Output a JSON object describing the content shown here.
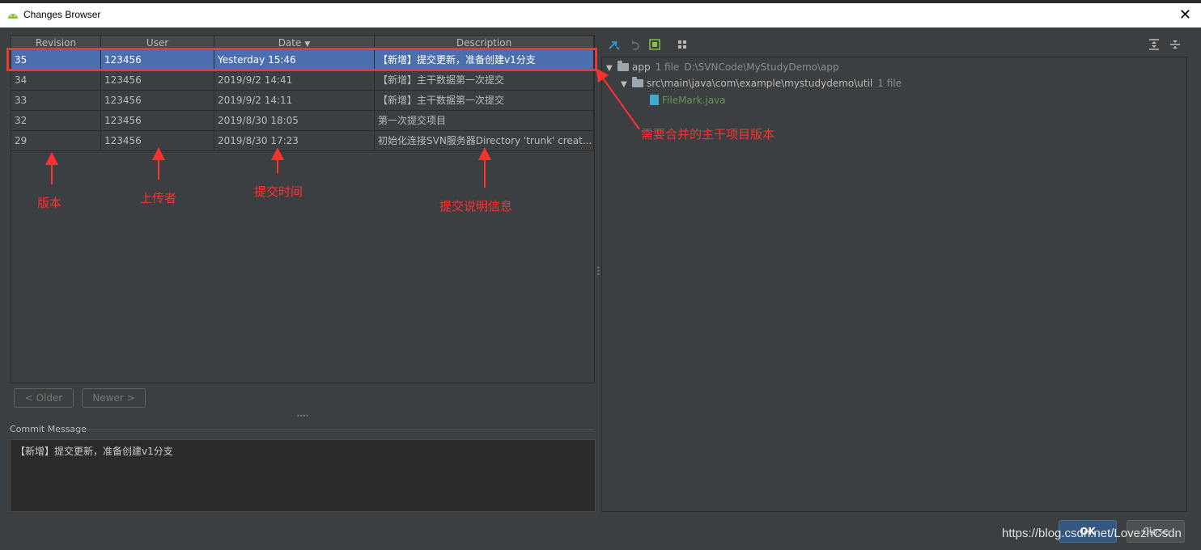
{
  "window": {
    "title": "Changes Browser",
    "close_glyph": "✕"
  },
  "table": {
    "columns": [
      "Revision",
      "User",
      "Date",
      "Description"
    ],
    "sort_indicator": "▼",
    "rows": [
      {
        "revision": "35",
        "user": "123456",
        "date": "Yesterday 15:46",
        "description": "【新增】提交更新，准备创建v1分支",
        "selected": true
      },
      {
        "revision": "34",
        "user": "123456",
        "date": "2019/9/2 14:41",
        "description": "【新增】主干数据第一次提交",
        "selected": false
      },
      {
        "revision": "33",
        "user": "123456",
        "date": "2019/9/2 14:11",
        "description": "【新增】主干数据第一次提交",
        "selected": false
      },
      {
        "revision": "32",
        "user": "123456",
        "date": "2019/8/30 18:05",
        "description": "第一次提交项目",
        "selected": false
      },
      {
        "revision": "29",
        "user": "123456",
        "date": "2019/8/30 17:23",
        "description": "初始化连接SVN服务器Directory 'trunk' creat...",
        "selected": false
      }
    ]
  },
  "nav": {
    "older_label": "< Older",
    "newer_label": "Newer >"
  },
  "commit": {
    "label": "Commit Message",
    "text": "【新增】提交更新，准备创建v1分支"
  },
  "tree": {
    "root": {
      "name": "app",
      "count": "1 file",
      "path": "D:\\SVNCode\\MyStudyDemo\\app"
    },
    "folder": {
      "name": "src\\main\\java\\com\\example\\mystudydemo\\util",
      "count": "1 file"
    },
    "file": {
      "name": "FileMark.java"
    }
  },
  "toolbar": {
    "icons": [
      "merge-arrow-icon",
      "revert-icon",
      "diff-icon",
      "group-by-icon",
      "expand-all-icon",
      "collapse-all-icon"
    ]
  },
  "annotations": {
    "revision": "版本",
    "user": "上传者",
    "date": "提交时间",
    "description": "提交说明信息",
    "trunk": "需要合并的主干项目版本"
  },
  "buttons": {
    "ok": "OK",
    "close": "Close"
  },
  "watermark": "https://blog.csdn.net/LovezhCsdn",
  "colors": {
    "selection": "#4b6eaf",
    "annotation": "#ff3030",
    "file": "#629755",
    "background": "#3c3f41"
  }
}
